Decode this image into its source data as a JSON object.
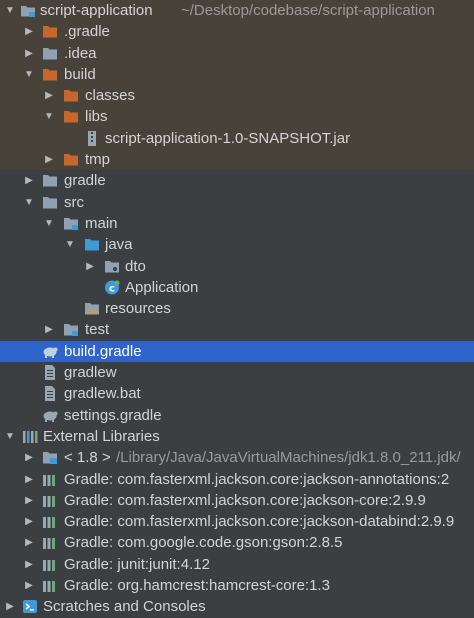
{
  "root": {
    "label": "script-application",
    "path": "~/Desktop/codebase/script-application"
  },
  "nodes": {
    "gradle_dir": ".gradle",
    "idea_dir": ".idea",
    "build_dir": "build",
    "classes_dir": "classes",
    "libs_dir": "libs",
    "jar_file": "script-application-1.0-SNAPSHOT.jar",
    "tmp_dir": "tmp",
    "gradle_folder": "gradle",
    "src_dir": "src",
    "main_dir": "main",
    "java_dir": "java",
    "dto_pkg": "dto",
    "application_class": "Application",
    "resources_dir": "resources",
    "test_dir": "test",
    "build_gradle": "build.gradle",
    "gradlew": "gradlew",
    "gradlew_bat": "gradlew.bat",
    "settings_gradle": "settings.gradle"
  },
  "external_libraries": {
    "label": "External Libraries",
    "jdk": {
      "label": "< 1.8 >",
      "path": "/Library/Java/JavaVirtualMachines/jdk1.8.0_211.jdk/"
    },
    "libs": [
      "Gradle: com.fasterxml.jackson.core:jackson-annotations:2",
      "Gradle: com.fasterxml.jackson.core:jackson-core:2.9.9",
      "Gradle: com.fasterxml.jackson.core:jackson-databind:2.9.9",
      "Gradle: com.google.code.gson:gson:2.8.5",
      "Gradle: junit:junit:4.12",
      "Gradle: org.hamcrest:hamcrest-core:1.3"
    ]
  },
  "scratches": "Scratches and Consoles",
  "colors": {
    "selection": "#2f65ca",
    "excluded": "#47433a",
    "background": "#3c3f41",
    "folder_excluded": "#c8672c",
    "folder_normal": "#8fa1b3",
    "folder_source": "#3f9ad6"
  }
}
